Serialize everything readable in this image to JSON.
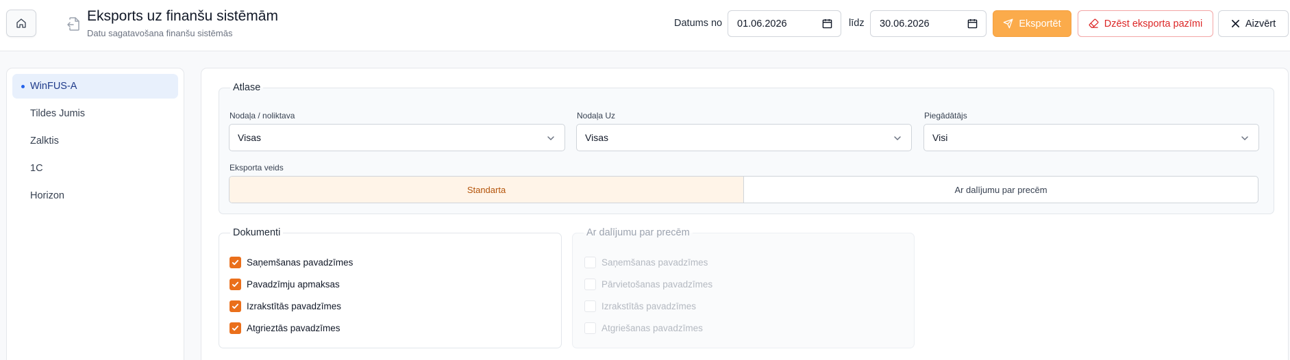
{
  "header": {
    "title": "Eksports uz finanšu sistēmām",
    "subtitle": "Datu sagatavošana finanšu sistēmās",
    "date_from_label": "Datums no",
    "date_from": "01.06.2026",
    "date_to_label": "līdz",
    "date_to": "30.06.2026",
    "export_label": "Eksportēt",
    "delete_label": "Dzēst eksporta pazīmi",
    "close_label": "Aizvērt"
  },
  "sidebar": {
    "items": [
      {
        "label": "WinFUS-A",
        "active": true
      },
      {
        "label": "Tildes Jumis",
        "active": false
      },
      {
        "label": "Zalktis",
        "active": false
      },
      {
        "label": "1C",
        "active": false
      },
      {
        "label": "Horizon",
        "active": false
      }
    ]
  },
  "filters": {
    "legend": "Atlase",
    "department_label": "Nodaļa / noliktava",
    "department_value": "Visas",
    "department_to_label": "Nodaļa Uz",
    "department_to_value": "Visas",
    "supplier_label": "Piegādātājs",
    "supplier_value": "Visi",
    "export_type_label": "Eksporta veids",
    "export_types": [
      {
        "label": "Standarta",
        "active": true
      },
      {
        "label": "Ar dalījumu par precēm",
        "active": false
      }
    ]
  },
  "documents": {
    "legend": "Dokumenti",
    "items": [
      {
        "label": "Saņemšanas pavadzīmes",
        "checked": true
      },
      {
        "label": "Pavadzīmju apmaksas",
        "checked": true
      },
      {
        "label": "Izrakstītās pavadzīmes",
        "checked": true
      },
      {
        "label": "Atgrieztās pavadzīmes",
        "checked": true
      }
    ]
  },
  "split_documents": {
    "legend": "Ar dalījumu par precēm",
    "items": [
      {
        "label": "Saņemšanas pavadzīmes",
        "checked": false
      },
      {
        "label": "Pārvietošanas pavadzīmes",
        "checked": false
      },
      {
        "label": "Izrakstītās pavadzīmes",
        "checked": false
      },
      {
        "label": "Atgriešanas pavadzīmes",
        "checked": false
      }
    ]
  },
  "colors": {
    "accent_orange": "#fbab4b",
    "checkbox_orange": "#ea6f1b",
    "danger": "#dc2626",
    "active_blue": "#2563eb"
  },
  "icons": {
    "home": "home-icon",
    "title": "file-export-icon",
    "calendar": "calendar-icon",
    "export": "send-icon",
    "delete": "eraser-icon",
    "close": "close-icon",
    "select": "chevron-down-icon"
  }
}
